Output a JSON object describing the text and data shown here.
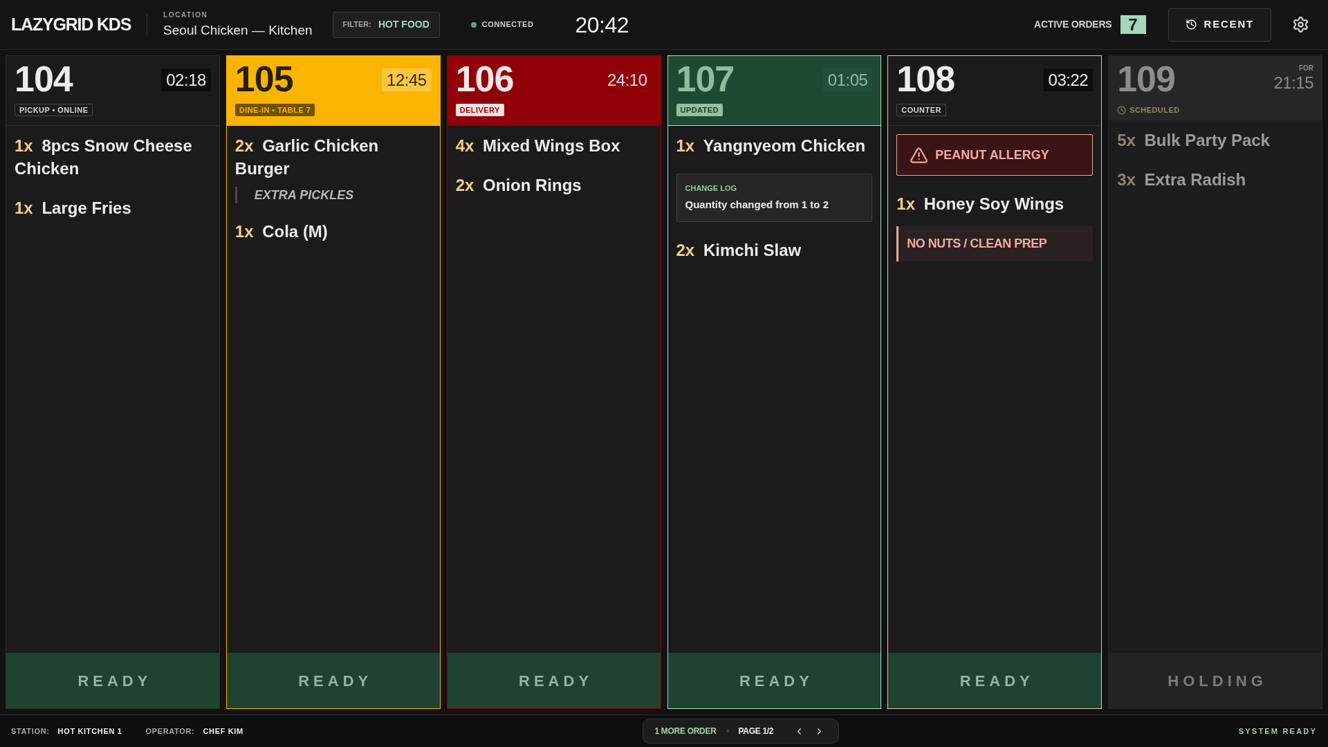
{
  "header": {
    "logo": "LAZYGRID KDS",
    "location": {
      "label": "LOCATION",
      "value": "Seoul Chicken — Kitchen"
    },
    "filter": {
      "label": "FILTER:",
      "value": "HOT FOOD"
    },
    "connection": {
      "label": "CONNECTED",
      "connected": true
    },
    "clock": "20:42",
    "active_orders": {
      "label": "ACTIVE ORDERS",
      "count": "7"
    },
    "recent_button": "RECENT"
  },
  "orders": [
    {
      "number": "104",
      "kind": "normal",
      "timer": "02:18",
      "tag": "PICKUP • ONLINE",
      "items": [
        {
          "kind": "item",
          "qty": "1x",
          "name": "8pcs Snow Cheese Chicken"
        },
        {
          "kind": "item",
          "qty": "1x",
          "name": "Large Fries"
        }
      ],
      "action": "READY"
    },
    {
      "number": "105",
      "kind": "warning",
      "timer": "12:45",
      "tag": "DINE-IN • TABLE 7",
      "items": [
        {
          "kind": "item",
          "qty": "2x",
          "name": "Garlic Chicken Burger",
          "modifiers": [
            "EXTRA PICKLES"
          ]
        },
        {
          "kind": "item",
          "qty": "1x",
          "name": "Cola (M)"
        }
      ],
      "action": "READY"
    },
    {
      "number": "106",
      "kind": "late",
      "timer": "24:10",
      "tag": "DELIVERY",
      "items": [
        {
          "kind": "item",
          "qty": "4x",
          "name": "Mixed Wings Box"
        },
        {
          "kind": "item",
          "qty": "2x",
          "name": "Onion Rings"
        }
      ],
      "action": "READY"
    },
    {
      "number": "107",
      "kind": "updated",
      "timer": "01:05",
      "tag": "UPDATED",
      "items": [
        {
          "kind": "item",
          "qty": "1x",
          "name": "Yangnyeom Chicken"
        },
        {
          "kind": "change_log",
          "label": "CHANGE LOG",
          "text": "Quantity changed from 1 to 2"
        },
        {
          "kind": "item",
          "qty": "2x",
          "name": "Kimchi Slaw"
        }
      ],
      "action": "READY"
    },
    {
      "number": "108",
      "kind": "allergy",
      "timer": "03:22",
      "tag": "COUNTER",
      "items": [
        {
          "kind": "allergy",
          "text": "PEANUT ALLERGY"
        },
        {
          "kind": "item",
          "qty": "1x",
          "name": "Honey Soy Wings",
          "note": "NO NUTS / CLEAN PREP"
        }
      ],
      "action": "READY"
    },
    {
      "number": "109",
      "kind": "scheduled",
      "timer_label": "FOR",
      "timer": "21:15",
      "tag": "SCHEDULED",
      "items": [
        {
          "kind": "item",
          "qty": "5x",
          "name": "Bulk Party Pack"
        },
        {
          "kind": "item",
          "qty": "3x",
          "name": "Extra Radish"
        }
      ],
      "action": "HOLDING"
    }
  ],
  "footer": {
    "station": {
      "label": "STATION:",
      "value": "HOT KITCHEN 1"
    },
    "operator": {
      "label": "OPERATOR:",
      "value": "CHEF KIM"
    },
    "pager": {
      "more": "1 MORE ORDER",
      "page": "PAGE 1/2"
    },
    "system_status": "SYSTEM READY"
  }
}
